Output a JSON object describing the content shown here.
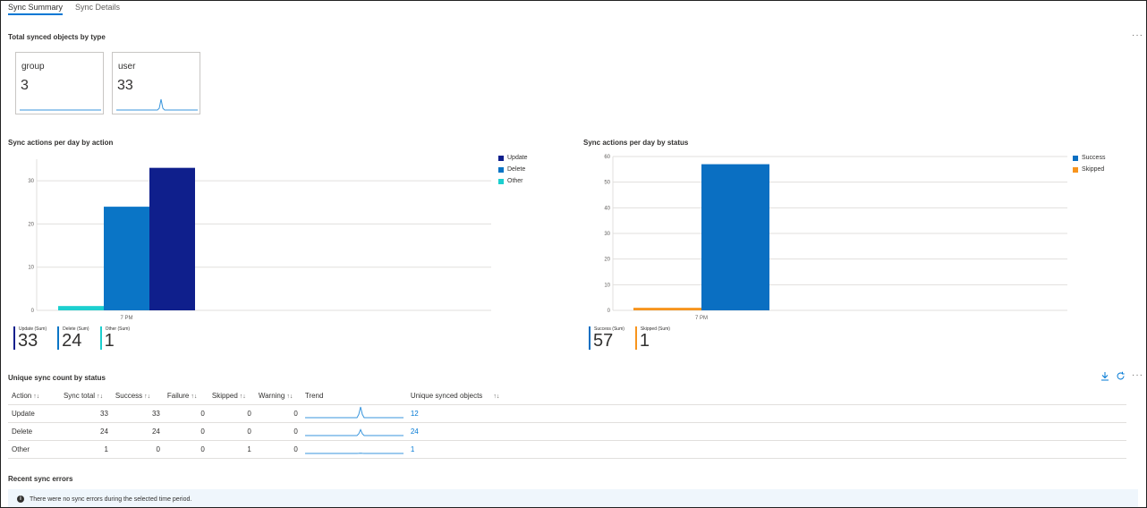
{
  "tabs": [
    {
      "label": "Sync Summary",
      "active": true
    },
    {
      "label": "Sync Details",
      "active": false
    }
  ],
  "colors": {
    "update": "#0f1f8c",
    "delete": "#0a75c6",
    "other": "#1ccfcf",
    "success": "#0a6fc2",
    "skipped": "#f7941d",
    "link": "#0078d4",
    "sparkline": "#3a96dd"
  },
  "objects_section": {
    "title": "Total synced objects by type",
    "more_label": "···",
    "tiles": [
      {
        "label": "group",
        "count": "3"
      },
      {
        "label": "user",
        "count": "33"
      }
    ]
  },
  "action_chart": {
    "title": "Sync actions per day by action",
    "summary": [
      {
        "label": "Update (Sum)",
        "value": "33"
      },
      {
        "label": "Delete (Sum)",
        "value": "24"
      },
      {
        "label": "Other (Sum)",
        "value": "1"
      }
    ]
  },
  "status_chart": {
    "title": "Sync actions per day by status",
    "summary": [
      {
        "label": "Success (Sum)",
        "value": "57"
      },
      {
        "label": "Skipped (Sum)",
        "value": "1"
      }
    ]
  },
  "chart_data": [
    {
      "type": "bar",
      "title": "Sync actions per day by action",
      "categories": [
        "7 PM"
      ],
      "series": [
        {
          "name": "Other",
          "values": [
            1
          ]
        },
        {
          "name": "Delete",
          "values": [
            24
          ]
        },
        {
          "name": "Update",
          "values": [
            33
          ]
        }
      ],
      "legend": [
        "Update",
        "Delete",
        "Other"
      ],
      "legend_placement": "right",
      "yticks": [
        0,
        10,
        20,
        30
      ],
      "ylim": [
        0,
        35
      ],
      "grid": true
    },
    {
      "type": "bar",
      "title": "Sync actions per day by status",
      "categories": [
        "7 PM"
      ],
      "series": [
        {
          "name": "Skipped",
          "values": [
            1
          ]
        },
        {
          "name": "Success",
          "values": [
            57
          ]
        }
      ],
      "legend": [
        "Success",
        "Skipped"
      ],
      "legend_placement": "right",
      "yticks": [
        0,
        10,
        20,
        30,
        40,
        50,
        60
      ],
      "ylim": [
        0,
        60
      ],
      "grid": true
    }
  ],
  "unique_section": {
    "title": "Unique sync count by status",
    "more_label": "···",
    "download_icon": "download-icon",
    "refresh_icon": "refresh-icon",
    "columns": [
      "Action",
      "Sync total",
      "Success",
      "Failure",
      "Skipped",
      "Warning",
      "Trend",
      "Unique synced objects"
    ],
    "sort_glyph": "↑↓",
    "rows": [
      {
        "action": "Update",
        "total": "33",
        "success": "33",
        "failure": "0",
        "skipped": "0",
        "warning": "0",
        "trend_peak": 1.0,
        "unique": "12"
      },
      {
        "action": "Delete",
        "total": "24",
        "success": "24",
        "failure": "0",
        "skipped": "0",
        "warning": "0",
        "trend_peak": 0.55,
        "unique": "24"
      },
      {
        "action": "Other",
        "total": "1",
        "success": "0",
        "failure": "0",
        "skipped": "1",
        "warning": "0",
        "trend_peak": 0.02,
        "unique": "1"
      }
    ]
  },
  "errors_section": {
    "title": "Recent sync errors",
    "message": "There were no sync errors during the selected time period.",
    "info_icon_glyph": "i"
  }
}
